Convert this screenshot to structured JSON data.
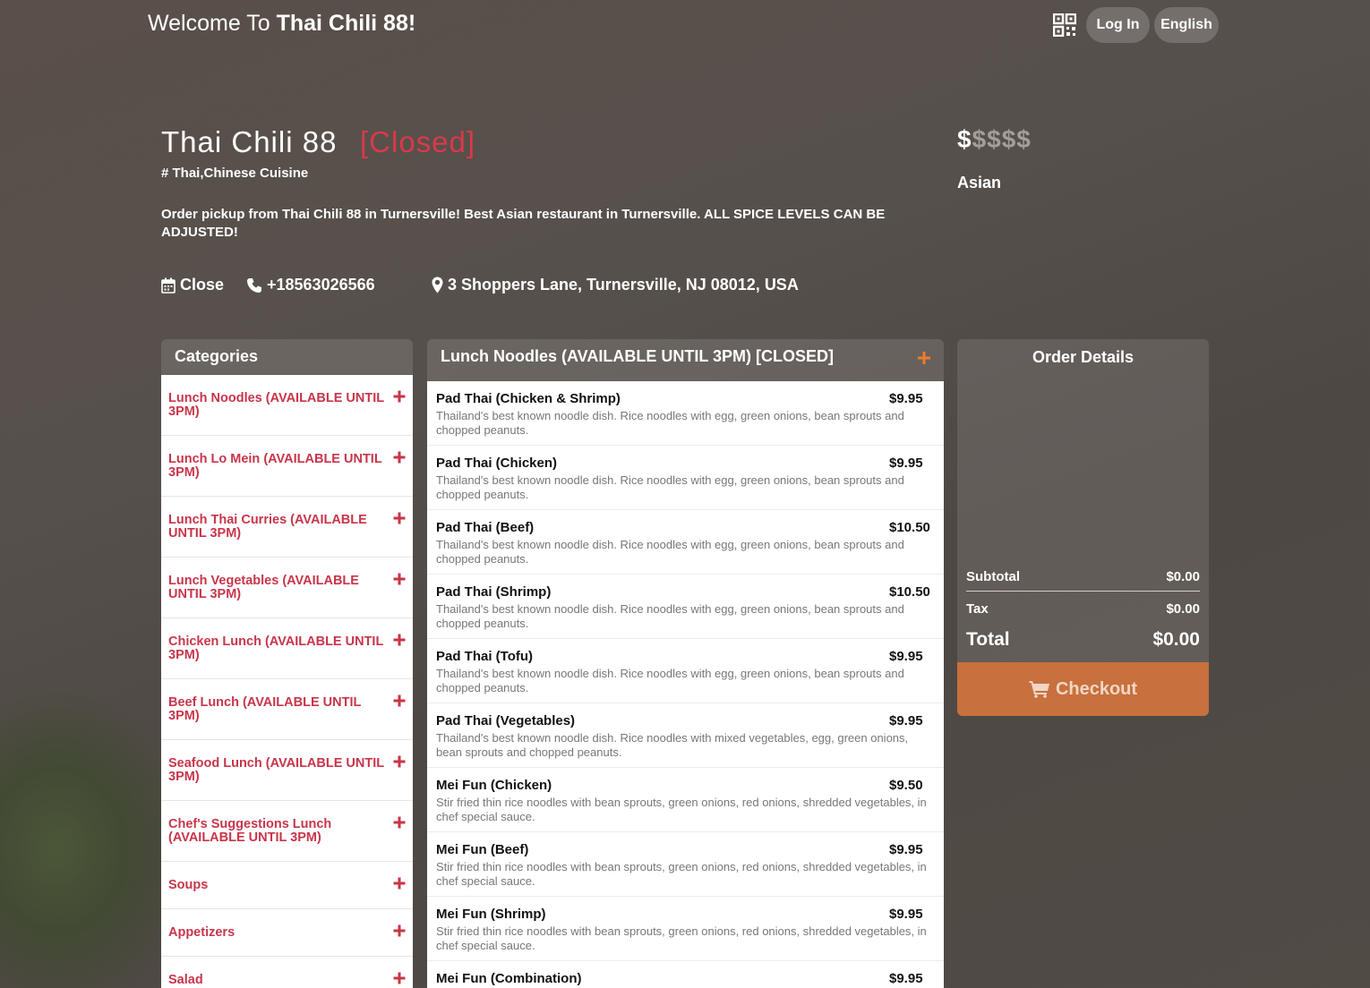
{
  "header": {
    "welcome_prefix": "Welcome To",
    "welcome_name": "Thai Chili 88!",
    "login_label": "Log In",
    "language_label": "English"
  },
  "restaurant": {
    "name": "Thai Chili 88",
    "status": "[Closed]",
    "cuisine": "# Thai,Chinese Cuisine",
    "description": "Order pickup from Thai Chili 88 in Turnersville! Best Asian restaurant in Turnersville. ALL SPICE LEVELS CAN BE ADJUSTED!",
    "hours": "Close",
    "phone": "+18563026566",
    "address": "3 Shoppers Lane, Turnersville, NJ 08012, USA",
    "price_active": "$",
    "price_inactive": "$$$$",
    "type": "Asian"
  },
  "categories": {
    "title": "Categories",
    "items": [
      "Lunch Noodles (AVAILABLE UNTIL 3PM)",
      "Lunch Lo Mein (AVAILABLE UNTIL 3PM)",
      "Lunch Thai Curries (AVAILABLE UNTIL 3PM)",
      "Lunch Vegetables (AVAILABLE UNTIL 3PM)",
      "Chicken Lunch (AVAILABLE UNTIL 3PM)",
      "Beef Lunch (AVAILABLE UNTIL 3PM)",
      "Seafood Lunch (AVAILABLE UNTIL 3PM)",
      "Chef's Suggestions Lunch (AVAILABLE UNTIL 3PM)",
      "Soups",
      "Appetizers",
      "Salad"
    ]
  },
  "menu": {
    "title": "Lunch Noodles (AVAILABLE UNTIL 3PM) [CLOSED]",
    "items": [
      {
        "name": "Pad Thai (Chicken & Shrimp)",
        "price": "$9.95",
        "desc": "Thailand's best known noodle dish. Rice noodles with egg, green onions, bean sprouts and chopped peanuts."
      },
      {
        "name": "Pad Thai (Chicken)",
        "price": "$9.95",
        "desc": "Thailand's best known noodle dish. Rice noodles with egg, green onions, bean sprouts and chopped peanuts."
      },
      {
        "name": "Pad Thai (Beef)",
        "price": "$10.50",
        "desc": "Thailand's best known noodle dish. Rice noodles with egg, green onions, bean sprouts and chopped peanuts."
      },
      {
        "name": "Pad Thai (Shrimp)",
        "price": "$10.50",
        "desc": "Thailand's best known noodle dish. Rice noodles with egg, green onions, bean sprouts and chopped peanuts."
      },
      {
        "name": "Pad Thai (Tofu)",
        "price": "$9.95",
        "desc": "Thailand's best known noodle dish. Rice noodles with egg, green onions, bean sprouts and chopped peanuts."
      },
      {
        "name": "Pad Thai (Vegetables)",
        "price": "$9.95",
        "desc": "Thailand's best known noodle dish. Rice noodles with mixed vegetables, egg, green onions, bean sprouts and chopped peanuts."
      },
      {
        "name": "Mei Fun (Chicken)",
        "price": "$9.50",
        "desc": "Stir fried thin rice noodles with bean sprouts, green onions, red onions, shredded vegetables, in chef special sauce."
      },
      {
        "name": "Mei Fun (Beef)",
        "price": "$9.95",
        "desc": "Stir fried thin rice noodles with bean sprouts, green onions, red onions, shredded vegetables, in chef special sauce."
      },
      {
        "name": "Mei Fun (Shrimp)",
        "price": "$9.95",
        "desc": "Stir fried thin rice noodles with bean sprouts, green onions, red onions, shredded vegetables, in chef special sauce."
      },
      {
        "name": "Mei Fun (Combination)",
        "price": "$9.95",
        "desc": ""
      }
    ]
  },
  "order": {
    "title": "Order Details",
    "subtotal_label": "Subtotal",
    "subtotal": "$0.00",
    "tax_label": "Tax",
    "tax": "$0.00",
    "total_label": "Total",
    "total": "$0.00",
    "checkout_label": "Checkout"
  },
  "colors": {
    "accent": "#c8354a",
    "closed": "#d9394a",
    "checkout": "#c8703e",
    "plus_orange": "#f07a2a"
  }
}
